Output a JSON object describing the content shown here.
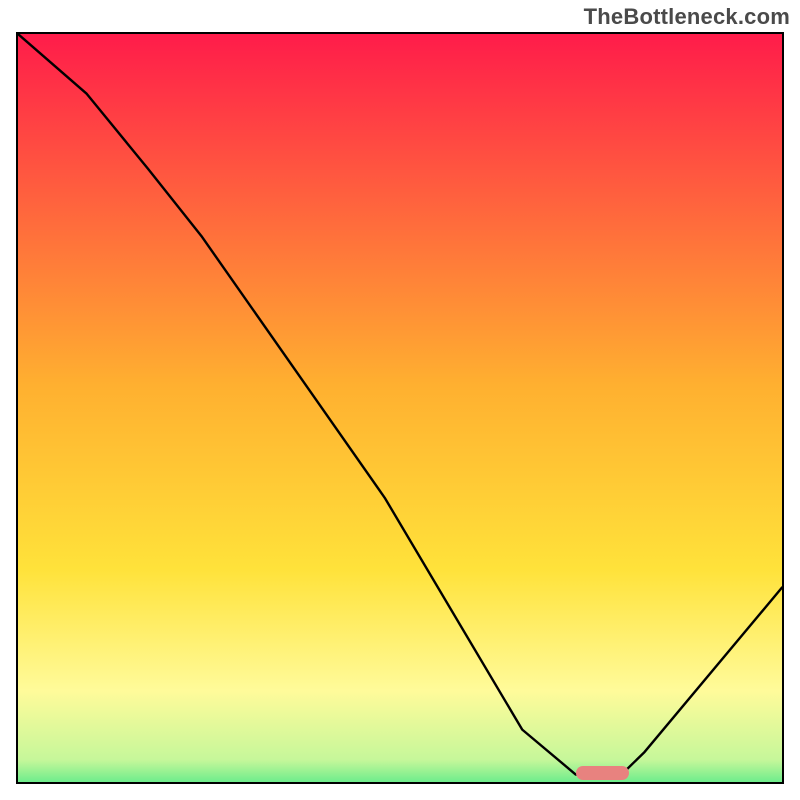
{
  "watermark": "TheBottleneck.com",
  "colors": {
    "top": "#ff1c4a",
    "mid": "#ffd23a",
    "lowYellow": "#fff99a",
    "green": "#2fe582",
    "curve": "#000000",
    "marker": "#e8827f",
    "border": "#000000"
  },
  "chart_data": {
    "type": "line",
    "title": "",
    "xlabel": "",
    "ylabel": "",
    "xlim": [
      0,
      100
    ],
    "ylim": [
      0,
      100
    ],
    "series": [
      {
        "name": "bottleneck-curve",
        "x": [
          0,
          9,
          17,
          24,
          48,
          66,
          73,
          79,
          82,
          100
        ],
        "y": [
          100,
          92,
          82,
          73,
          38,
          7,
          1,
          1,
          4,
          26
        ]
      }
    ],
    "marker": {
      "x_start": 73,
      "x_end": 80,
      "y": 1.2
    },
    "gradient_stops": [
      {
        "pct": 0,
        "color": "#ff1c4a"
      },
      {
        "pct": 46,
        "color": "#ffb030"
      },
      {
        "pct": 70,
        "color": "#ffe23a"
      },
      {
        "pct": 86,
        "color": "#fffb9a"
      },
      {
        "pct": 95,
        "color": "#c6f79a"
      },
      {
        "pct": 100,
        "color": "#2fe582"
      }
    ]
  }
}
